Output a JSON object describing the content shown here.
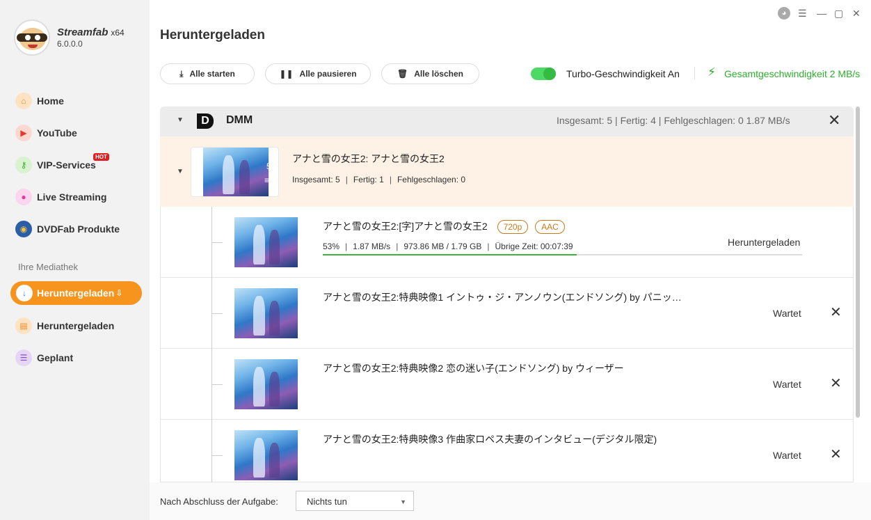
{
  "app": {
    "name": "Streamfab",
    "arch": "x64",
    "version": "6.0.0.0"
  },
  "sidebar": {
    "items": [
      {
        "label": "Home",
        "icon": "home-icon"
      },
      {
        "label": "YouTube",
        "icon": "youtube-icon"
      },
      {
        "label": "VIP-Services",
        "icon": "key-icon",
        "badge": "HOT"
      },
      {
        "label": "Live Streaming",
        "icon": "camera-icon"
      },
      {
        "label": "DVDFab Produkte",
        "icon": "dvdfab-icon"
      }
    ],
    "library_title": "Ihre Mediathek",
    "library": [
      {
        "label": "Heruntergeladen",
        "icon": "download-icon",
        "active": true
      },
      {
        "label": "Heruntergeladen",
        "icon": "folder-icon"
      },
      {
        "label": "Geplant",
        "icon": "calendar-icon"
      }
    ]
  },
  "header": {
    "title": "Heruntergeladen"
  },
  "toolbar": {
    "start_all": "Alle starten",
    "pause_all": "Alle pausieren",
    "delete_all": "Alle löschen",
    "turbo_label": "Turbo-Geschwindigkeit An",
    "turbo_on": true,
    "total_speed": "Gesamtgeschwindigkeit 2 MB/s"
  },
  "group": {
    "logo": "D",
    "name": "DMM",
    "stats": "Insgesamt: 5 | Fertig: 4 | Fehlgeschlagen: 0   1.87 MB/s"
  },
  "title_row": {
    "title": "アナと雪の女王2: アナと雪の女王2",
    "count": "5",
    "total": "Insgesamt:  5",
    "done": "Fertig:  1",
    "failed": "Fehlgeschlagen:  0"
  },
  "items": [
    {
      "title": "アナと雪の女王2:[字]アナと雪の女王2",
      "res": "720p",
      "audio": "AAC",
      "percent": "53%",
      "speed": "1.87 MB/s",
      "size": "973.86 MB / 1.79 GB",
      "remaining": "Übrige Zeit: 00:07:39",
      "status": "Heruntergeladen",
      "progress": 0.53
    },
    {
      "title": "アナと雪の女王2:特典映像1 イントゥ・ジ・アンノウン(エンドソング)   by パニッ…",
      "status": "Wartet"
    },
    {
      "title": "アナと雪の女王2:特典映像2 恋の迷い子(エンドソング)   by ウィーザー",
      "status": "Wartet"
    },
    {
      "title": "アナと雪の女王2:特典映像3 作曲家ロペス夫妻のインタビュー(デジタル限定)",
      "status": "Wartet"
    }
  ],
  "footer": {
    "label": "Nach Abschluss der Aufgabe:",
    "select_value": "Nichts tun"
  }
}
